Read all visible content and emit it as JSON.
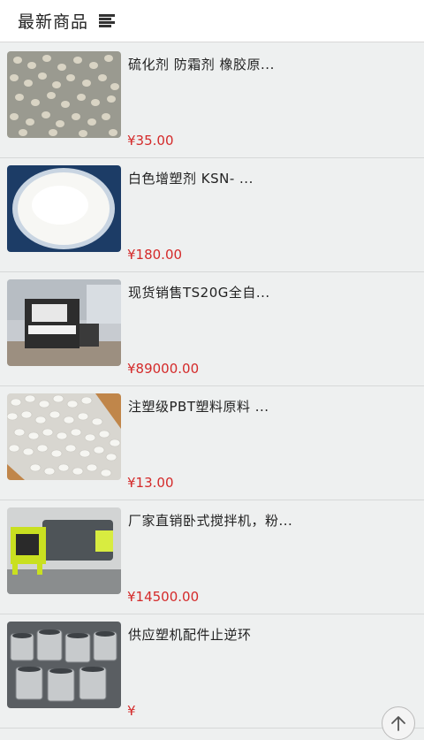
{
  "header": {
    "title": "最新商品",
    "menu_icon": "menu-icon"
  },
  "products": [
    {
      "name": "硫化剂 防霜剂 橡胶原...",
      "price": "¥35.00"
    },
    {
      "name": "白色增塑剂 KSN- ...",
      "price": "¥180.00"
    },
    {
      "name": "现货销售TS20G全自...",
      "price": "¥89000.00"
    },
    {
      "name": "注塑级PBT塑料原料 ...",
      "price": "¥13.00"
    },
    {
      "name": "厂家直销卧式搅拌机，粉...",
      "price": "¥14500.00"
    },
    {
      "name": "供应塑机配件止逆环",
      "price": "¥"
    }
  ],
  "back_to_top_icon": "arrow-up-icon",
  "colors": {
    "price": "#d42a2a",
    "background": "#eef0f0",
    "header_bg": "#ffffff"
  }
}
